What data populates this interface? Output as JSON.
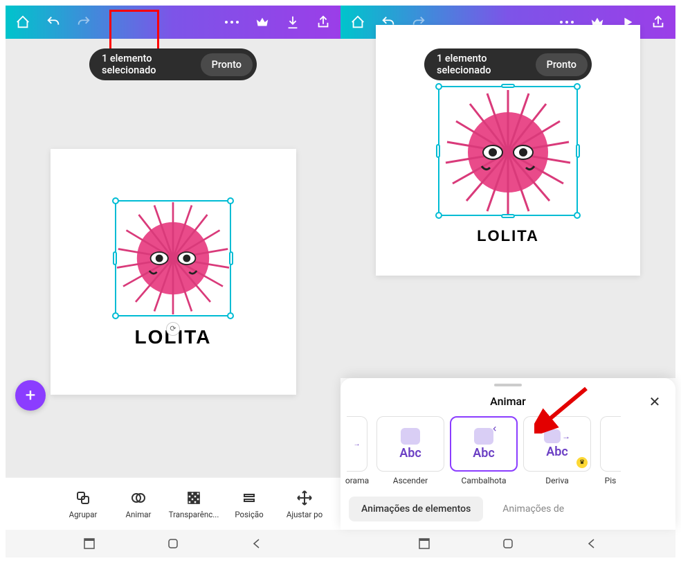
{
  "selection": {
    "text": "1 elemento selecionado",
    "done": "Pronto"
  },
  "logo_text": "LOLITA",
  "toolbar": {
    "group": "Agrupar",
    "animate": "Animar",
    "transparency": "Transparênc...",
    "position": "Posição",
    "adjust": "Ajustar po"
  },
  "sheet": {
    "title": "Animar",
    "items": {
      "panorama": "orama",
      "ascender": "Ascender",
      "cambalhota": "Cambalhota",
      "deriva": "Deriva",
      "pis": "Pis"
    },
    "tabs": {
      "elements": "Animações de elementos",
      "other": "Animações de"
    },
    "abc": "Abc"
  }
}
